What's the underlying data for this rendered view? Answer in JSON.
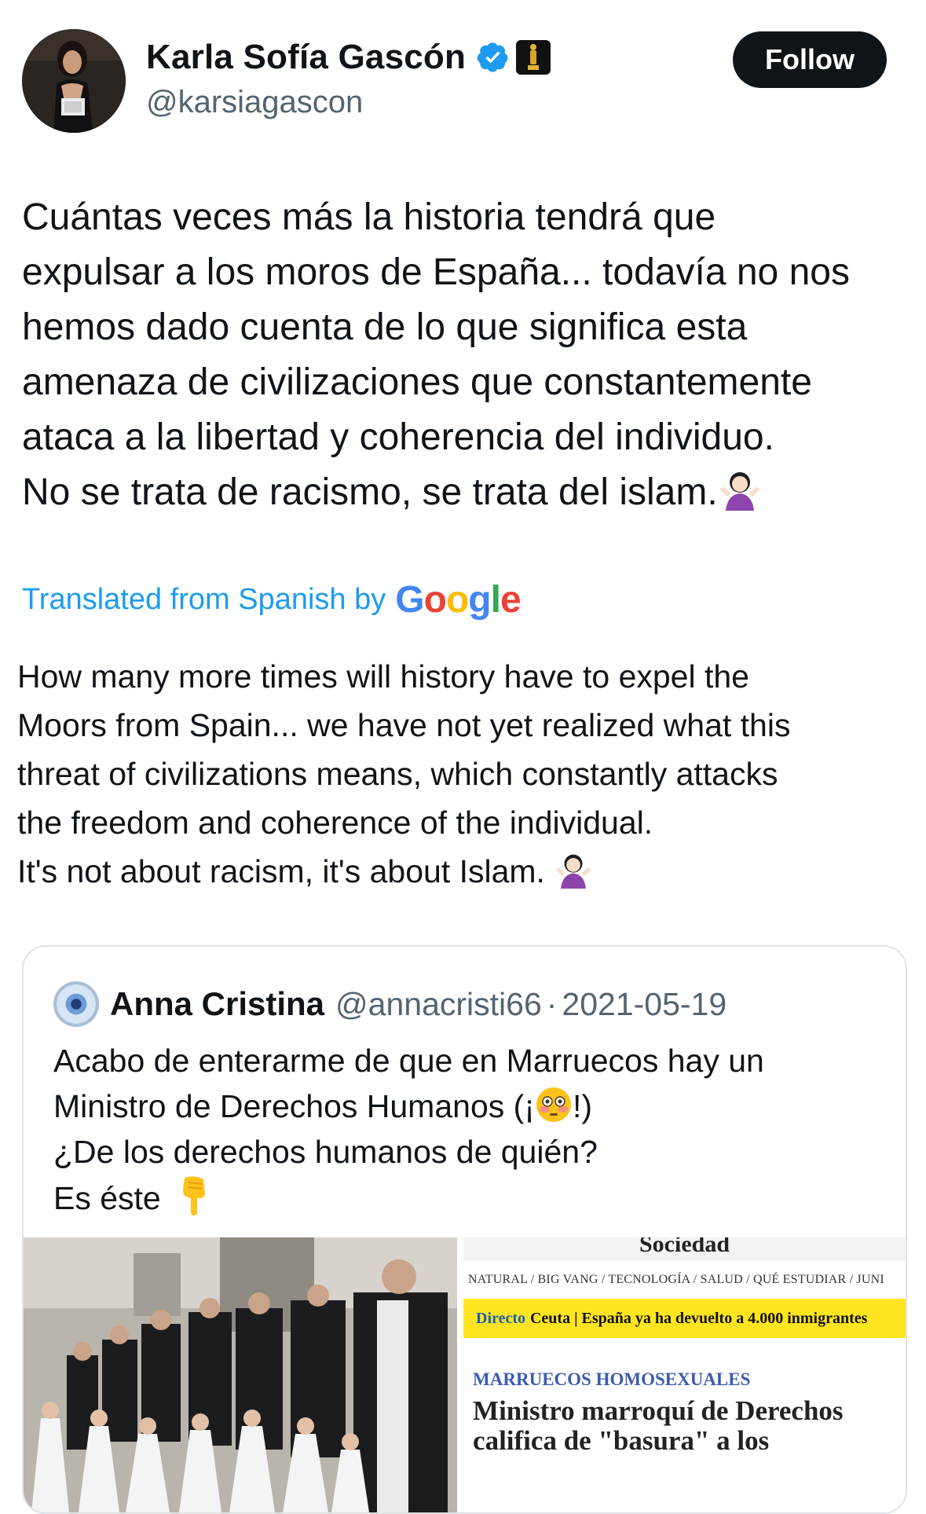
{
  "author": {
    "name": "Karla Sofía Gascón",
    "handle": "@karsiagascon",
    "follow_label": "Follow"
  },
  "tweet": {
    "lines": [
      "Cuántas veces más la historia tendrá que",
      "expulsar a los moros de España... todavía no nos",
      "hemos dado cuenta de lo que significa esta",
      "amenaza de civilizaciones que constantemente",
      "ataca a la libertad y coherencia del individuo.",
      "No se trata de racismo, se trata del islam."
    ]
  },
  "translation": {
    "label": "Translated from Spanish by",
    "provider": "Google",
    "lines": [
      "How many more times will history have to expel the",
      "Moors from Spain... we have not yet realized what this",
      "threat of civilizations means, which constantly attacks",
      "the freedom and coherence of the individual.",
      "It's not about racism, it's about Islam. "
    ]
  },
  "quote": {
    "name": "Anna Cristina",
    "handle": "@annacristi66",
    "separator": "·",
    "date": "2021-05-19",
    "lines": [
      "Acabo de enterarme de que en Marruecos hay un",
      "Ministro de Derechos Humanos (¡",
      "¿De los derechos humanos de quién?",
      "Es éste"
    ],
    "line2_end": "!)",
    "news": {
      "section": "Sociedad",
      "nav": "NATURAL  /  BIG VANG  /  TECNOLOGÍA  /  SALUD  /  QUÉ ESTUDIAR  /  JUNI",
      "directo": "Directo",
      "bar_text": "Ceuta | España ya ha devuelto a 4.000 inmigrantes",
      "kicker": "MARRUECOS HOMOSEXUALES",
      "headline": [
        "Ministro marroquí de Derechos",
        "califica de \"basura\" a los"
      ]
    }
  },
  "colors": {
    "accent_blue": "#1d9bf0",
    "text": "#0f1419",
    "secondary": "#536471",
    "news_yellow": "#ffe51f"
  },
  "icons": {
    "verified": "verified-badge-icon",
    "affiliate": "oscar-statuette-icon",
    "shrug": "woman-shrugging-emoji",
    "flushed": "flushed-face-emoji",
    "pointing_down": "backhand-index-pointing-down-emoji"
  }
}
